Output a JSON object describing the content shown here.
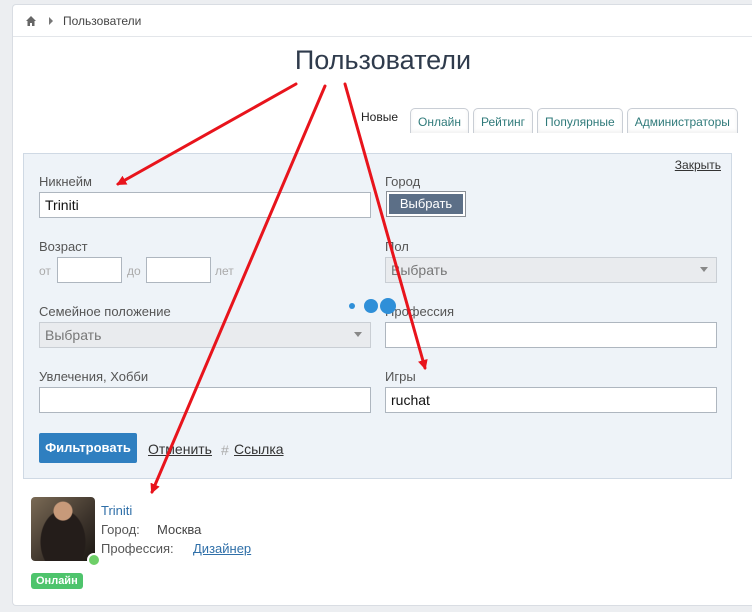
{
  "breadcrumb": {
    "home_icon": "home-icon",
    "separator_icon": "chevron-right-icon",
    "current": "Пользователи"
  },
  "page_title": "Пользователи",
  "tabs": [
    {
      "label": "Новые",
      "active": true
    },
    {
      "label": "Онлайн"
    },
    {
      "label": "Рейтинг"
    },
    {
      "label": "Популярные"
    },
    {
      "label": "Администраторы"
    }
  ],
  "filter": {
    "hide_label": "Закрыть",
    "nickname": {
      "label": "Никнейм",
      "value": "Triniti"
    },
    "city": {
      "label": "Город",
      "button": "Выбрать"
    },
    "age": {
      "label": "Возраст",
      "from": "от",
      "to": "до",
      "unit": "лет"
    },
    "gender": {
      "label": "Пол",
      "value": "Выбрать"
    },
    "marital": {
      "label": "Семейное положение",
      "value": "Выбрать"
    },
    "profession": {
      "label": "Профессия",
      "value": ""
    },
    "hobbies": {
      "label": "Увлечения, Хобби",
      "value": ""
    },
    "games": {
      "label": "Игры",
      "value": "ruchat"
    },
    "submit": "Фильтровать",
    "cancel": "Отменить",
    "link_hash": "#",
    "link": "Ссылка"
  },
  "user": {
    "name": "Triniti",
    "city_label": "Город:",
    "city": "Москва",
    "profession_label": "Профессия:",
    "profession": "Дизайнер",
    "status": "Онлайн"
  },
  "colors": {
    "accent": "#2f7fc0",
    "arrow": "#e8141c",
    "online": "#4ec46c"
  }
}
